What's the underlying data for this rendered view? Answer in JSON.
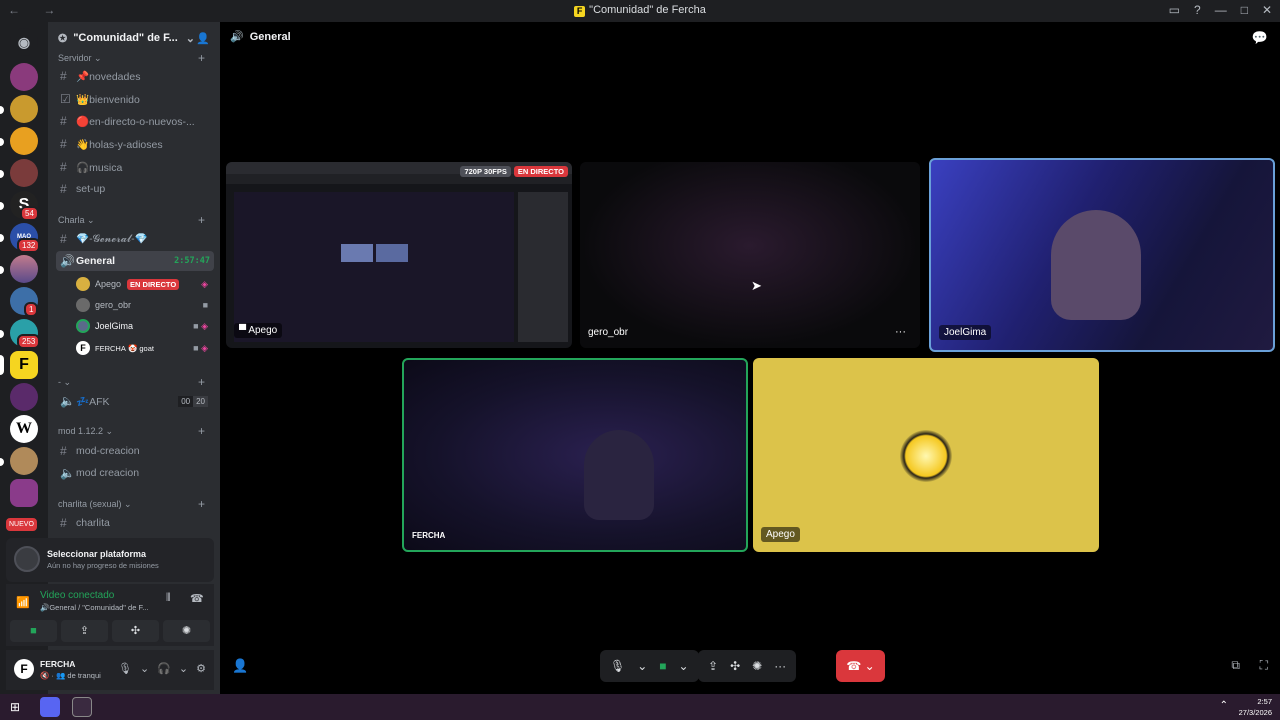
{
  "window": {
    "title": "\"Comunidad\" de Fercha",
    "nav": "← →"
  },
  "guild": {
    "name": "\"Comunidad\" de F..."
  },
  "categories": {
    "servidor": "Servidor",
    "charla": "Charla",
    "dash": "- ",
    "mod": "mod 1.12.2",
    "charlita": "charlita (sexual)"
  },
  "channels": {
    "novedades": "📌novedades",
    "bienvenido": "👑bienvenido",
    "directo": "🔴en-directo-o-nuevos-...",
    "holas": "👋holas-y-adioses",
    "musica": "🎧musica",
    "setup": "set-up",
    "general_text": "💎-𝓖𝓮𝓷𝓮𝓻𝓪𝓵-💎",
    "general_voice": "General",
    "general_timer": "2:57:47",
    "afk": "💤AFK",
    "afk_count_a": "00",
    "afk_count_b": "20",
    "mod_creacion_text": "mod-creacion",
    "mod_creacion_voice": "mod creacion",
    "charlita": "charlita"
  },
  "voice_users": [
    {
      "name": "Apego",
      "live": "EN DIRECTO"
    },
    {
      "name": "gero_obr"
    },
    {
      "name": "JoelGima"
    },
    {
      "name": "FERCHA",
      "suffix": "🤡 goat"
    }
  ],
  "server_badges": {
    "b1": "54",
    "b2": "132",
    "b3": "1",
    "b4": "253",
    "nuevo": "NUEVO"
  },
  "promo": {
    "title": "Seleccionar plataforma",
    "subtitle": "Aún no hay progreso de misiones"
  },
  "voice_panel": {
    "status": "Video conectado",
    "channel": "🔊General / \"Comunidad\" de F..."
  },
  "user": {
    "name": "FERCHA",
    "status": "🔇 · 👥 de tranqui",
    "avatar": "F"
  },
  "stage": {
    "channel": "General"
  },
  "tiles": {
    "stream": {
      "name": "Apego",
      "res": "720P 30FPS",
      "live": "EN DIRECTO"
    },
    "gero": {
      "name": "gero_obr",
      "more": "···"
    },
    "joel": {
      "name": "JoelGima"
    },
    "fercha": {
      "name": "FERCHA"
    },
    "apego": {
      "name": "Apego"
    }
  },
  "taskbar": {
    "time": "2:57",
    "date": "27/3/2026"
  },
  "colors": {
    "accent": "#5865f2",
    "green": "#23a55a",
    "red": "#da373c",
    "yellow_tile": "#dcc34a"
  }
}
